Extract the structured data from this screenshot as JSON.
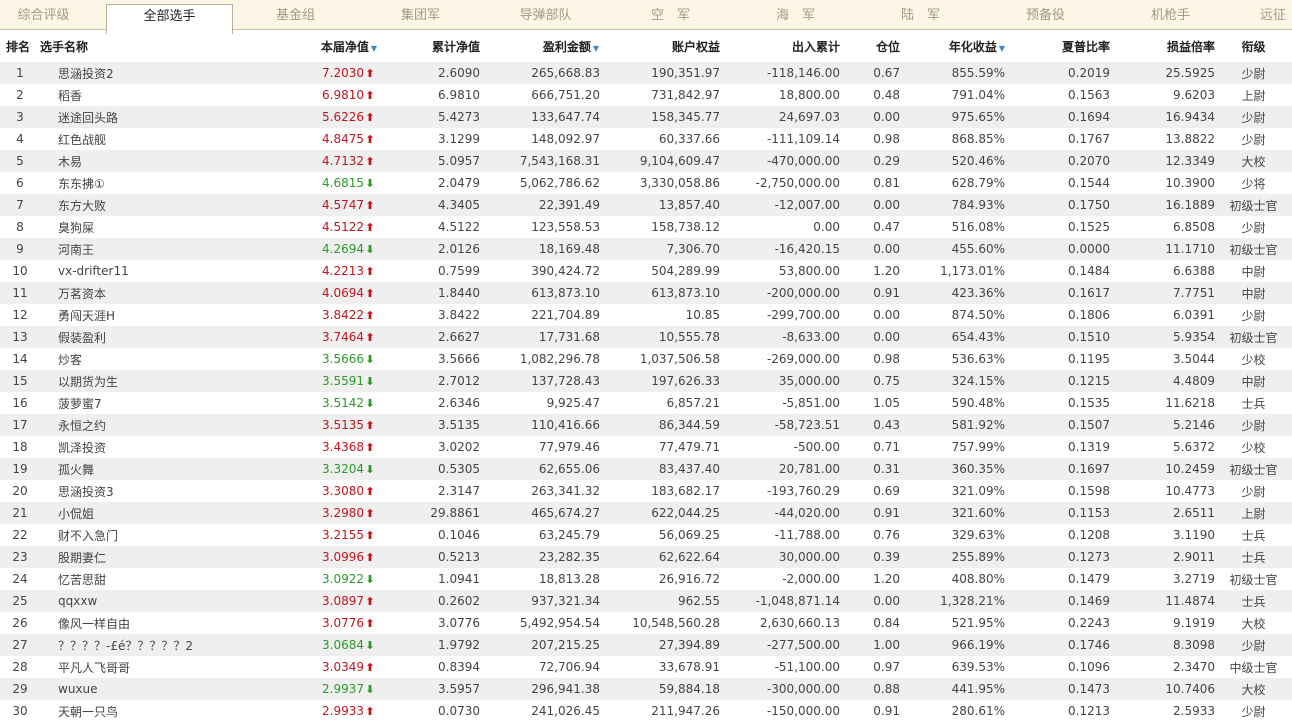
{
  "tabs": [
    "综合评级",
    "全部选手",
    "基金组",
    "集团军",
    "导弹部队",
    "空　军",
    "海　军",
    "陆　军",
    "预备役",
    "机枪手",
    "远征"
  ],
  "active_tab_index": 1,
  "columns": {
    "rank": "排名",
    "name": "选手名称",
    "nav": "本届净值",
    "cum_nav": "累计净值",
    "profit": "盈利金额",
    "equity": "账户权益",
    "flow": "出入累计",
    "position": "仓位",
    "annual": "年化收益",
    "sharpe": "夏普比率",
    "pl_ratio": "损益倍率",
    "title": "衔级"
  },
  "sort_icon": "▼",
  "colors": {
    "up": "#c0141e",
    "down": "#2a9a2a",
    "stripe": "#efefef",
    "tabbar": "#fbf6e5"
  },
  "rows": [
    {
      "rank": "1",
      "name": "思涵投资2",
      "nav": "7.2030",
      "dir": "up",
      "cum_nav": "2.6090",
      "profit": "265,668.83",
      "equity": "190,351.97",
      "flow": "-118,146.00",
      "position": "0.67",
      "annual": "855.59%",
      "sharpe": "0.2019",
      "pl_ratio": "25.5925",
      "title": "少尉"
    },
    {
      "rank": "2",
      "name": "稻香",
      "nav": "6.9810",
      "dir": "up",
      "cum_nav": "6.9810",
      "profit": "666,751.20",
      "equity": "731,842.97",
      "flow": "18,800.00",
      "position": "0.48",
      "annual": "791.04%",
      "sharpe": "0.1563",
      "pl_ratio": "9.6203",
      "title": "上尉"
    },
    {
      "rank": "3",
      "name": "迷途回头路",
      "nav": "5.6226",
      "dir": "up",
      "cum_nav": "5.4273",
      "profit": "133,647.74",
      "equity": "158,345.77",
      "flow": "24,697.03",
      "position": "0.00",
      "annual": "975.65%",
      "sharpe": "0.1694",
      "pl_ratio": "16.9434",
      "title": "少尉"
    },
    {
      "rank": "4",
      "name": "红色战舰",
      "nav": "4.8475",
      "dir": "up",
      "cum_nav": "3.1299",
      "profit": "148,092.97",
      "equity": "60,337.66",
      "flow": "-111,109.14",
      "position": "0.98",
      "annual": "868.85%",
      "sharpe": "0.1767",
      "pl_ratio": "13.8822",
      "title": "少尉"
    },
    {
      "rank": "5",
      "name": "木易",
      "nav": "4.7132",
      "dir": "up",
      "cum_nav": "5.0957",
      "profit": "7,543,168.31",
      "equity": "9,104,609.47",
      "flow": "-470,000.00",
      "position": "0.29",
      "annual": "520.46%",
      "sharpe": "0.2070",
      "pl_ratio": "12.3349",
      "title": "大校"
    },
    {
      "rank": "6",
      "name": "东东拂①",
      "nav": "4.6815",
      "dir": "down",
      "cum_nav": "2.0479",
      "profit": "5,062,786.62",
      "equity": "3,330,058.86",
      "flow": "-2,750,000.00",
      "position": "0.81",
      "annual": "628.79%",
      "sharpe": "0.1544",
      "pl_ratio": "10.3900",
      "title": "少将"
    },
    {
      "rank": "7",
      "name": "东方大败",
      "nav": "4.5747",
      "dir": "up",
      "cum_nav": "4.3405",
      "profit": "22,391.49",
      "equity": "13,857.40",
      "flow": "-12,007.00",
      "position": "0.00",
      "annual": "784.93%",
      "sharpe": "0.1750",
      "pl_ratio": "16.1889",
      "title": "初级士官"
    },
    {
      "rank": "8",
      "name": "臭狗屎",
      "nav": "4.5122",
      "dir": "up",
      "cum_nav": "4.5122",
      "profit": "123,558.53",
      "equity": "158,738.12",
      "flow": "0.00",
      "position": "0.47",
      "annual": "516.08%",
      "sharpe": "0.1525",
      "pl_ratio": "6.8508",
      "title": "少尉"
    },
    {
      "rank": "9",
      "name": "河南王",
      "nav": "4.2694",
      "dir": "down",
      "cum_nav": "2.0126",
      "profit": "18,169.48",
      "equity": "7,306.70",
      "flow": "-16,420.15",
      "position": "0.00",
      "annual": "455.60%",
      "sharpe": "0.0000",
      "pl_ratio": "11.1710",
      "title": "初级士官"
    },
    {
      "rank": "10",
      "name": "vx-drifter11",
      "nav": "4.2213",
      "dir": "up",
      "cum_nav": "0.7599",
      "profit": "390,424.72",
      "equity": "504,289.99",
      "flow": "53,800.00",
      "position": "1.20",
      "annual": "1,173.01%",
      "sharpe": "0.1484",
      "pl_ratio": "6.6388",
      "title": "中尉"
    },
    {
      "rank": "11",
      "name": "万茗资本",
      "nav": "4.0694",
      "dir": "up",
      "cum_nav": "1.8440",
      "profit": "613,873.10",
      "equity": "613,873.10",
      "flow": "-200,000.00",
      "position": "0.91",
      "annual": "423.36%",
      "sharpe": "0.1617",
      "pl_ratio": "7.7751",
      "title": "中尉"
    },
    {
      "rank": "12",
      "name": "勇闯天涯H",
      "nav": "3.8422",
      "dir": "up",
      "cum_nav": "3.8422",
      "profit": "221,704.89",
      "equity": "10.85",
      "flow": "-299,700.00",
      "position": "0.00",
      "annual": "874.50%",
      "sharpe": "0.1806",
      "pl_ratio": "6.0391",
      "title": "少尉"
    },
    {
      "rank": "13",
      "name": "假装盈利",
      "nav": "3.7464",
      "dir": "up",
      "cum_nav": "2.6627",
      "profit": "17,731.68",
      "equity": "10,555.78",
      "flow": "-8,633.00",
      "position": "0.00",
      "annual": "654.43%",
      "sharpe": "0.1510",
      "pl_ratio": "5.9354",
      "title": "初级士官"
    },
    {
      "rank": "14",
      "name": "炒客",
      "nav": "3.5666",
      "dir": "down",
      "cum_nav": "3.5666",
      "profit": "1,082,296.78",
      "equity": "1,037,506.58",
      "flow": "-269,000.00",
      "position": "0.98",
      "annual": "536.63%",
      "sharpe": "0.1195",
      "pl_ratio": "3.5044",
      "title": "少校"
    },
    {
      "rank": "15",
      "name": "以期货为生",
      "nav": "3.5591",
      "dir": "down",
      "cum_nav": "2.7012",
      "profit": "137,728.43",
      "equity": "197,626.33",
      "flow": "35,000.00",
      "position": "0.75",
      "annual": "324.15%",
      "sharpe": "0.1215",
      "pl_ratio": "4.4809",
      "title": "中尉"
    },
    {
      "rank": "16",
      "name": "菠萝蜜7",
      "nav": "3.5142",
      "dir": "down",
      "cum_nav": "2.6346",
      "profit": "9,925.47",
      "equity": "6,857.21",
      "flow": "-5,851.00",
      "position": "1.05",
      "annual": "590.48%",
      "sharpe": "0.1535",
      "pl_ratio": "11.6218",
      "title": "士兵"
    },
    {
      "rank": "17",
      "name": "永恒之约",
      "nav": "3.5135",
      "dir": "up",
      "cum_nav": "3.5135",
      "profit": "110,416.66",
      "equity": "86,344.59",
      "flow": "-58,723.51",
      "position": "0.43",
      "annual": "581.92%",
      "sharpe": "0.1507",
      "pl_ratio": "5.2146",
      "title": "少尉"
    },
    {
      "rank": "18",
      "name": "凯泽投资",
      "nav": "3.4368",
      "dir": "up",
      "cum_nav": "3.0202",
      "profit": "77,979.46",
      "equity": "77,479.71",
      "flow": "-500.00",
      "position": "0.71",
      "annual": "757.99%",
      "sharpe": "0.1319",
      "pl_ratio": "5.6372",
      "title": "少校"
    },
    {
      "rank": "19",
      "name": "孤火舞",
      "nav": "3.3204",
      "dir": "down",
      "cum_nav": "0.5305",
      "profit": "62,655.06",
      "equity": "83,437.40",
      "flow": "20,781.00",
      "position": "0.31",
      "annual": "360.35%",
      "sharpe": "0.1697",
      "pl_ratio": "10.2459",
      "title": "初级士官"
    },
    {
      "rank": "20",
      "name": "思涵投资3",
      "nav": "3.3080",
      "dir": "up",
      "cum_nav": "2.3147",
      "profit": "263,341.32",
      "equity": "183,682.17",
      "flow": "-193,760.29",
      "position": "0.69",
      "annual": "321.09%",
      "sharpe": "0.1598",
      "pl_ratio": "10.4773",
      "title": "少尉"
    },
    {
      "rank": "21",
      "name": "小侃姐",
      "nav": "3.2980",
      "dir": "up",
      "cum_nav": "29.8861",
      "profit": "465,674.27",
      "equity": "622,044.25",
      "flow": "-44,020.00",
      "position": "0.91",
      "annual": "321.60%",
      "sharpe": "0.1153",
      "pl_ratio": "2.6511",
      "title": "上尉"
    },
    {
      "rank": "22",
      "name": "财不入急门",
      "nav": "3.2155",
      "dir": "up",
      "cum_nav": "0.1046",
      "profit": "63,245.79",
      "equity": "56,069.25",
      "flow": "-11,788.00",
      "position": "0.76",
      "annual": "329.63%",
      "sharpe": "0.1208",
      "pl_ratio": "3.1190",
      "title": "士兵"
    },
    {
      "rank": "23",
      "name": "股期妻仁",
      "nav": "3.0996",
      "dir": "up",
      "cum_nav": "0.5213",
      "profit": "23,282.35",
      "equity": "62,622.64",
      "flow": "30,000.00",
      "position": "0.39",
      "annual": "255.89%",
      "sharpe": "0.1273",
      "pl_ratio": "2.9011",
      "title": "士兵"
    },
    {
      "rank": "24",
      "name": "忆苦思甜",
      "nav": "3.0922",
      "dir": "down",
      "cum_nav": "1.0941",
      "profit": "18,813.28",
      "equity": "26,916.72",
      "flow": "-2,000.00",
      "position": "1.20",
      "annual": "408.80%",
      "sharpe": "0.1479",
      "pl_ratio": "3.2719",
      "title": "初级士官"
    },
    {
      "rank": "25",
      "name": "qqxxw",
      "nav": "3.0897",
      "dir": "up",
      "cum_nav": "0.2602",
      "profit": "937,321.34",
      "equity": "962.55",
      "flow": "-1,048,871.14",
      "position": "0.00",
      "annual": "1,328.21%",
      "sharpe": "0.1469",
      "pl_ratio": "11.4874",
      "title": "士兵"
    },
    {
      "rank": "26",
      "name": "像风一样自由",
      "nav": "3.0776",
      "dir": "up",
      "cum_nav": "3.0776",
      "profit": "5,492,954.54",
      "equity": "10,548,560.28",
      "flow": "2,630,660.13",
      "position": "0.84",
      "annual": "521.95%",
      "sharpe": "0.2243",
      "pl_ratio": "9.1919",
      "title": "大校"
    },
    {
      "rank": "27",
      "name": "？？？？-£é？？？？？2",
      "nav": "3.0684",
      "dir": "down",
      "cum_nav": "1.9792",
      "profit": "207,215.25",
      "equity": "27,394.89",
      "flow": "-277,500.00",
      "position": "1.00",
      "annual": "966.19%",
      "sharpe": "0.1746",
      "pl_ratio": "8.3098",
      "title": "少尉"
    },
    {
      "rank": "28",
      "name": "平凡人飞哥哥",
      "nav": "3.0349",
      "dir": "up",
      "cum_nav": "0.8394",
      "profit": "72,706.94",
      "equity": "33,678.91",
      "flow": "-51,100.00",
      "position": "0.97",
      "annual": "639.53%",
      "sharpe": "0.1096",
      "pl_ratio": "2.3470",
      "title": "中级士官"
    },
    {
      "rank": "29",
      "name": "wuxue",
      "nav": "2.9937",
      "dir": "down",
      "cum_nav": "3.5957",
      "profit": "296,941.38",
      "equity": "59,884.18",
      "flow": "-300,000.00",
      "position": "0.88",
      "annual": "441.95%",
      "sharpe": "0.1473",
      "pl_ratio": "10.7406",
      "title": "大校"
    },
    {
      "rank": "30",
      "name": "天朝一只鸟",
      "nav": "2.9933",
      "dir": "up",
      "cum_nav": "0.0730",
      "profit": "241,026.45",
      "equity": "211,947.26",
      "flow": "-150,000.00",
      "position": "0.91",
      "annual": "280.61%",
      "sharpe": "0.1213",
      "pl_ratio": "2.5933",
      "title": "少尉"
    }
  ]
}
